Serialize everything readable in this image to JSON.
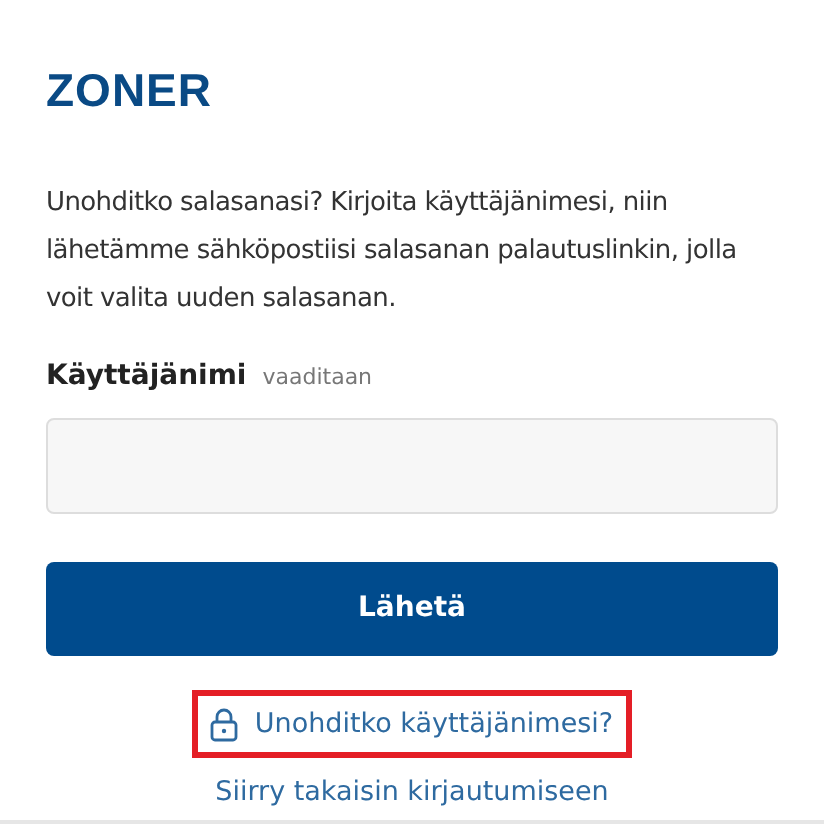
{
  "logo": "ZONER",
  "intro": "Unohditko salasanasi? Kirjoita käyttäjänimesi, niin lähetämme sähköpostiisi salasanan palautuslinkin, jolla voit valita uuden salasanan.",
  "field": {
    "label": "Käyttäjänimi",
    "hint": "vaaditaan"
  },
  "submit": "Lähetä",
  "links": [
    {
      "kind": "lock",
      "label": "Unohditko käyttäjänimesi?",
      "highlighted": true
    },
    {
      "kind": "plain",
      "label": "Siirry takaisin kirjautumiseen",
      "highlighted": false
    }
  ]
}
